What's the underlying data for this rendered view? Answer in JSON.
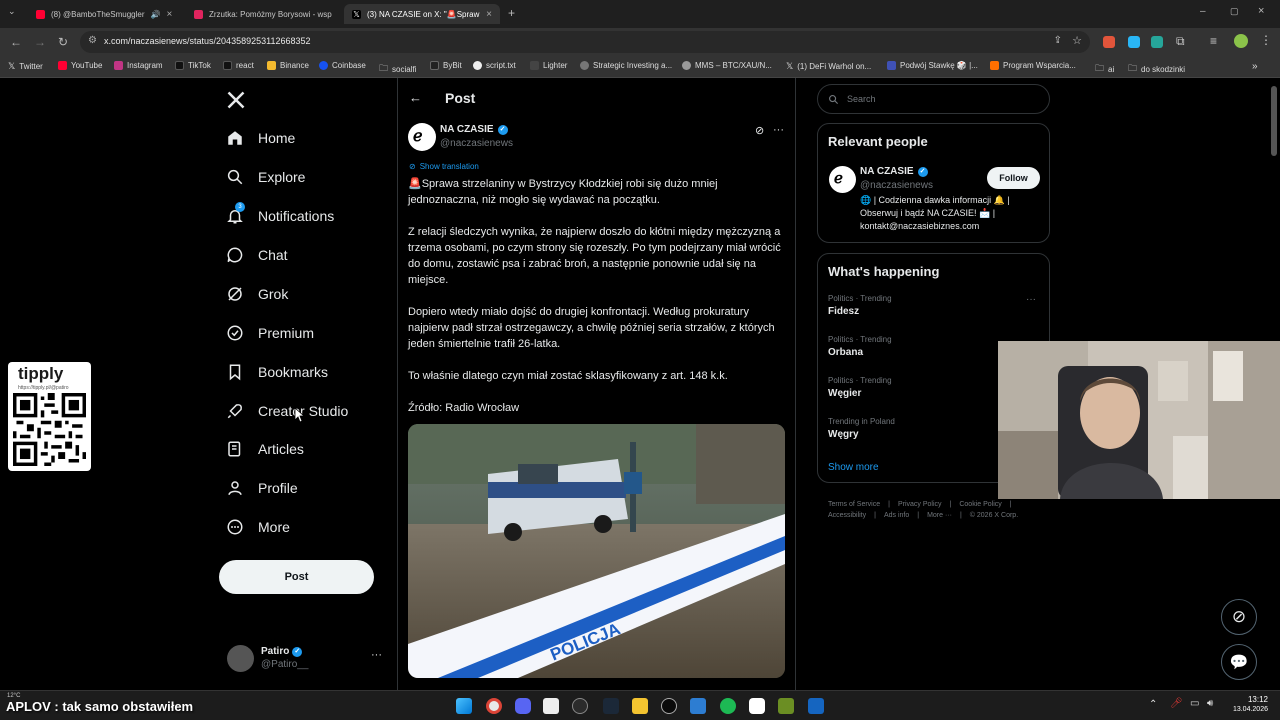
{
  "browser": {
    "tabs": [
      {
        "label": "(8) @BamboTheSmuggler",
        "color": "#ff0033"
      },
      {
        "label": "Zrzutka: Pomóżmy Borysowi - wsp",
        "color": "#e0245e"
      },
      {
        "label": "(3) NA CZASIE on X: \"🚨Spraw",
        "color": "#ffffff"
      }
    ],
    "url": "x.com/naczasienews/status/2043589253112668352",
    "bookmarks": [
      "Twitter",
      "YouTube",
      "Instagram",
      "TikTok",
      "react",
      "Binance",
      "Coinbase",
      "socialfi",
      "ByBit",
      "script.txt",
      "Lighter",
      "Strategic Investing a...",
      "MMS – BTC/XAU/N...",
      "(1) DeFi Warhol on...",
      "Podwój Stawkę 🎲 |...",
      "Program Wsparcia...",
      "ai",
      "do skodzinki"
    ]
  },
  "sidebar": {
    "items": [
      {
        "label": "Home",
        "icon": "home-icon"
      },
      {
        "label": "Explore",
        "icon": "search-icon"
      },
      {
        "label": "Notifications",
        "icon": "bell-icon",
        "badge": "3"
      },
      {
        "label": "Chat",
        "icon": "chat-icon"
      },
      {
        "label": "Grok",
        "icon": "grok-icon"
      },
      {
        "label": "Premium",
        "icon": "premium-icon"
      },
      {
        "label": "Bookmarks",
        "icon": "bookmark-icon"
      },
      {
        "label": "Creator Studio",
        "icon": "rocket-icon"
      },
      {
        "label": "Articles",
        "icon": "articles-icon"
      },
      {
        "label": "Profile",
        "icon": "profile-icon"
      },
      {
        "label": "More",
        "icon": "more-icon"
      }
    ],
    "post_button": "Post",
    "account": {
      "name": "Patiro",
      "handle": "@Patiro__"
    }
  },
  "post": {
    "header": "Post",
    "author_name": "NA CZASIE",
    "author_handle": "@naczasienews",
    "show_translation": "Show translation",
    "paragraphs": [
      "🚨Sprawa strzelaniny w Bystrzycy Kłodzkiej robi się dużo mniej jednoznaczna, niż mogło się wydawać na początku.",
      "Z relacji śledczych wynika, że najpierw doszło do kłótni między mężczyzną a trzema osobami, po czym strony się rozeszły. Po tym podejrzany miał wrócić do domu, zostawić psa i zabrać broń, a następnie ponownie udał się na miejsce.",
      "Dopiero wtedy miało dojść do drugiej konfrontacji. Według prokuratury najpierw padł strzał ostrzegawczy, a chwilę później seria strzałów, z których jeden śmiertelnie trafił 26-latka.",
      "To właśnie dlatego czyn miał zostać sklasyfikowany z art. 148 k.k.",
      "Źródło: Radio Wrocław"
    ],
    "image_tape_text": "POLICJA"
  },
  "right": {
    "search_placeholder": "Search",
    "relevant_title": "Relevant people",
    "person": {
      "name": "NA CZASIE",
      "handle": "@naczasienews",
      "follow": "Follow",
      "bio": "🌐 | Codzienna dawka informacji 🔔 | Obserwuj i bądź NA CZASIE! 📩 | kontakt@naczasiebiznes.com"
    },
    "happening_title": "What's happening",
    "trends": [
      {
        "context": "Politics · Trending",
        "name": "Fidesz"
      },
      {
        "context": "Politics · Trending",
        "name": "Orbana"
      },
      {
        "context": "Politics · Trending",
        "name": "Węgier"
      },
      {
        "context": "Trending in Poland",
        "name": "Węgry"
      }
    ],
    "show_more": "Show more",
    "footer": [
      "Terms of Service",
      "Privacy Policy",
      "Cookie Policy",
      "Accessibility",
      "Ads info",
      "More ···",
      "© 2026 X Corp."
    ]
  },
  "overlays": {
    "tipply_title": "tipply",
    "tipply_url": "https://tipply.pl/@patiro",
    "subtitle": "APLOV : tak samo obstawiłem"
  },
  "taskbar": {
    "weather": "12°C",
    "time": "13:12",
    "date": "13.04.2026"
  }
}
